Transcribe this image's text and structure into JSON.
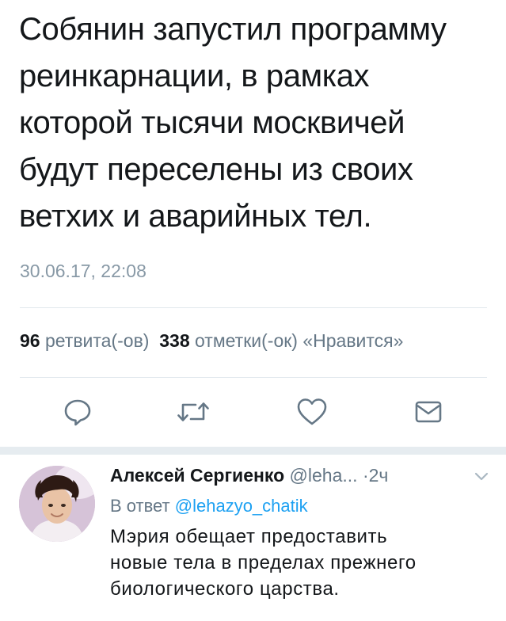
{
  "tweet": {
    "text_lines": [
      "Собянин запустил программу",
      "реинкарнации, в рамках",
      "которой тысячи москвичей",
      "будут переселены из своих",
      "ветхих и аварийных тел."
    ],
    "timestamp": "30.06.17, 22:08"
  },
  "stats": {
    "retweets_count": "96",
    "retweets_label": "ретвита(-ов)",
    "likes_count": "338",
    "likes_label": "отметки(-ок) «Нравится»"
  },
  "actions": {
    "reply_icon": "reply-icon",
    "retweet_icon": "retweet-icon",
    "like_icon": "heart-icon",
    "dm_icon": "envelope-icon"
  },
  "reply": {
    "author_name": "Алексей Сергиенко",
    "author_handle": "@leha...",
    "separator": "·",
    "time": "2ч",
    "in_reply_prefix": "В ответ",
    "in_reply_mention": "@lehazyo_chatik",
    "text_lines": [
      "Мэрия обещает предоставить",
      "новые тела в пределах прежнего",
      "биологического царства."
    ]
  },
  "colors": {
    "text": "#14171a",
    "secondary": "#657786",
    "timestamp": "#8899a6",
    "accent": "#1da1f2",
    "icon": "#657786",
    "divider": "#e1e8ed"
  }
}
